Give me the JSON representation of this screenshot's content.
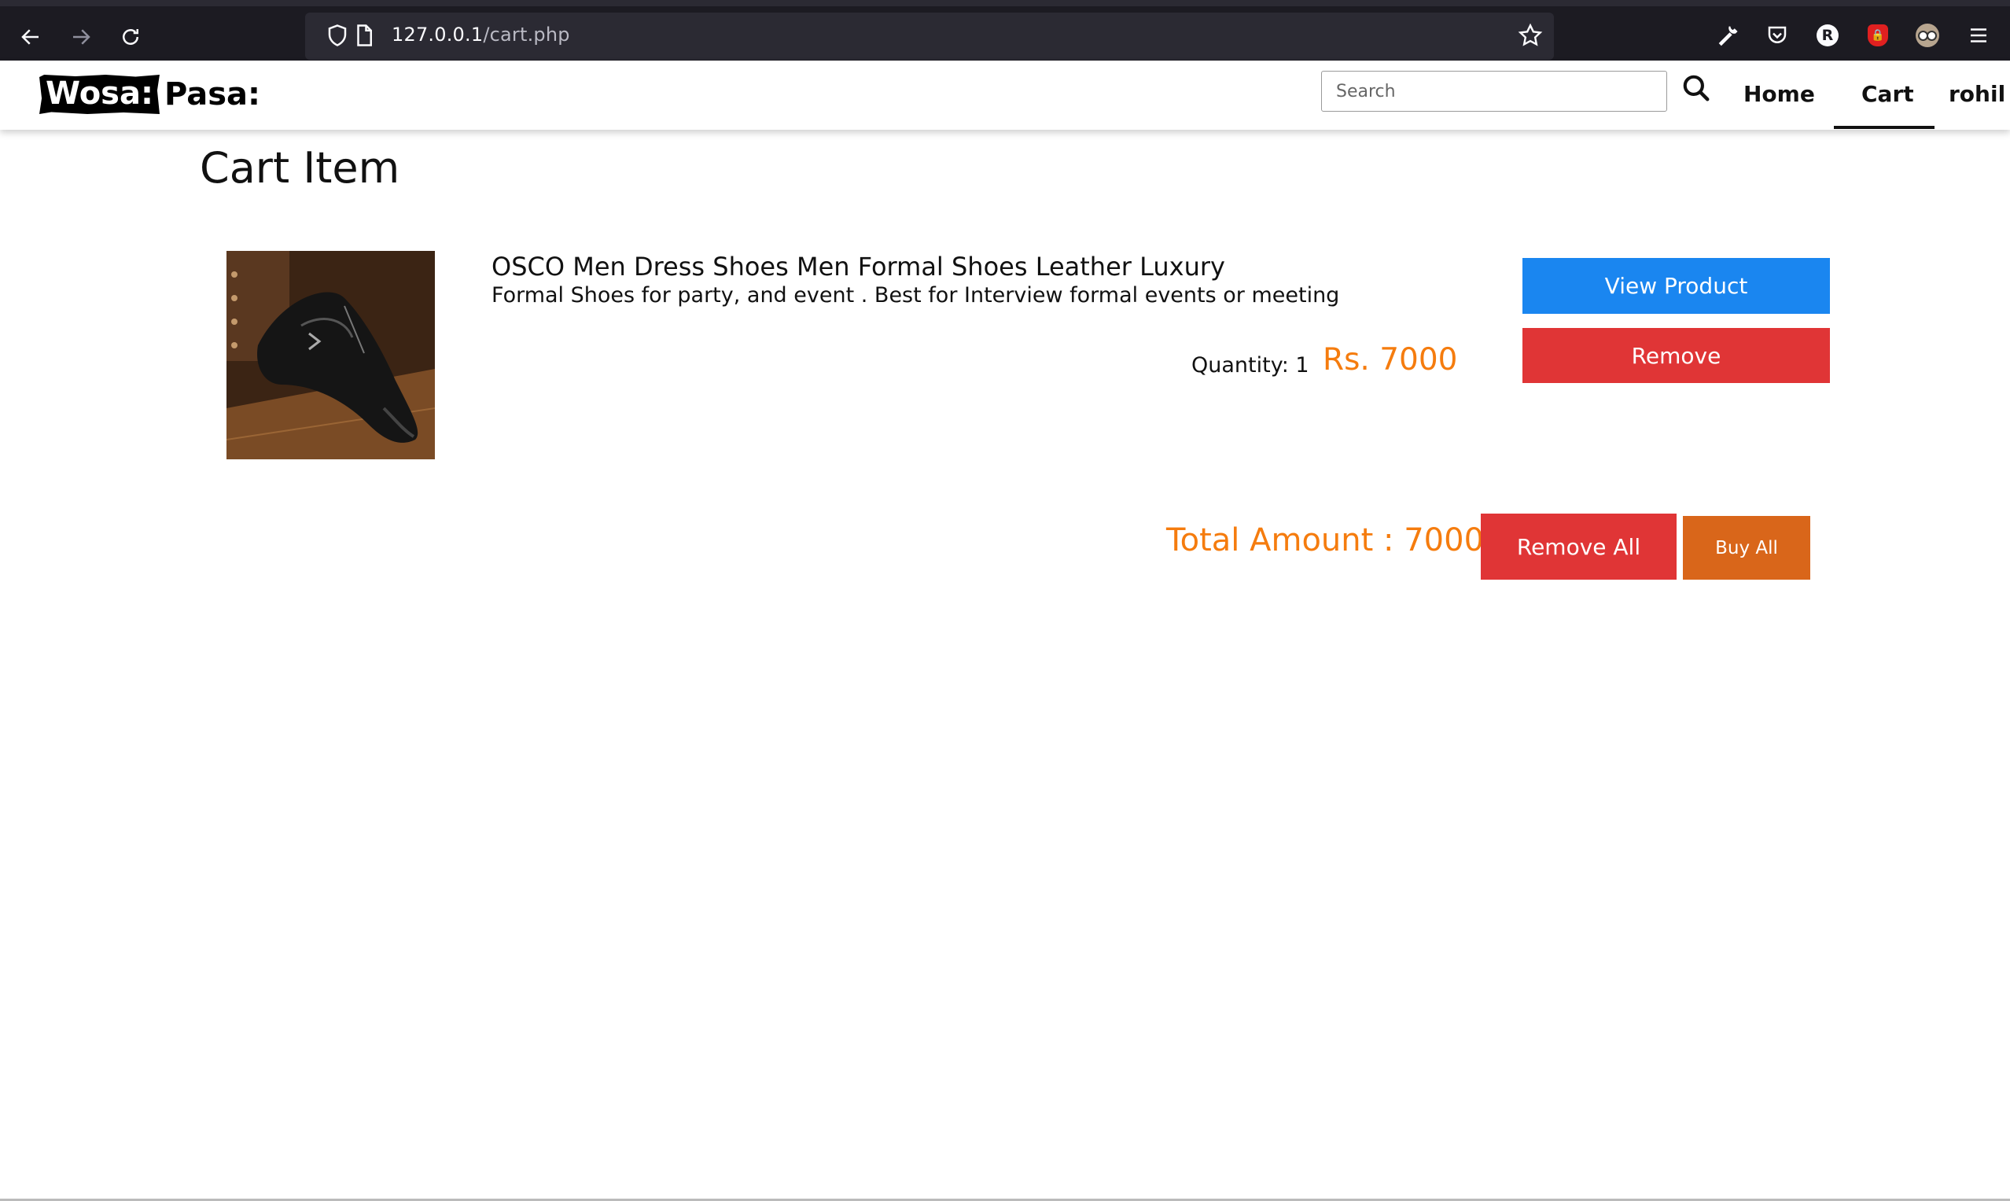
{
  "browser": {
    "url_host": "127.0.0.1",
    "url_path": "/cart.php"
  },
  "site": {
    "logo_box": "Wosa:",
    "logo_text": "Pasa:",
    "search_placeholder": "Search",
    "nav": {
      "home": "Home",
      "cart": "Cart",
      "user": "rohil"
    }
  },
  "cart": {
    "title": "Cart Item",
    "items": [
      {
        "name": "OSCO Men Dress Shoes Men Formal Shoes Leather Luxury",
        "description": "Formal Shoes for party, and event . Best for Interview formal events or meeting",
        "quantity_label": "Quantity: 1",
        "price": "Rs. 7000",
        "view_label": "View Product",
        "remove_label": "Remove"
      }
    ],
    "total_label": "Total Amount : 7000",
    "remove_all_label": "Remove All",
    "buy_all_label": "Buy All"
  },
  "colors": {
    "accent_orange": "#f57c0e",
    "button_blue": "#1a86f0",
    "button_red": "#e03536",
    "button_orange": "#d9661a"
  }
}
